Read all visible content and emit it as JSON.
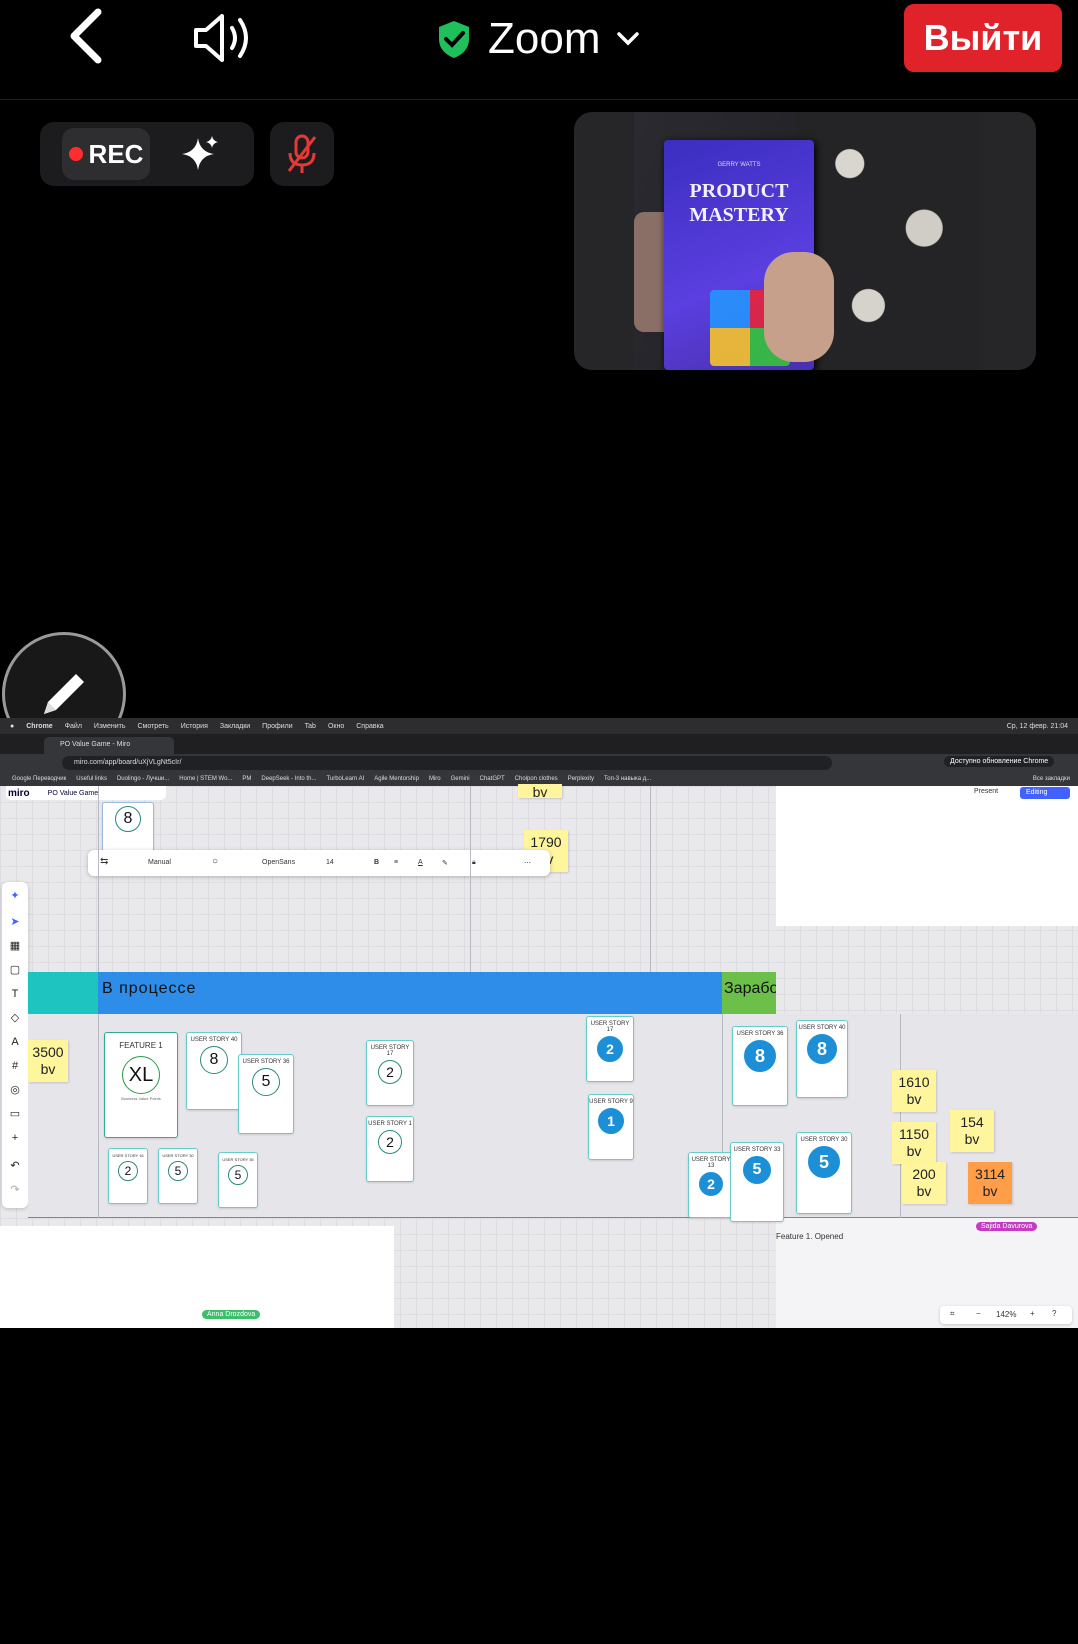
{
  "zoom": {
    "title": "Zoom",
    "exit_label": "Выйти",
    "rec_label": "REC",
    "accent_exit": "#e0232b",
    "shield_color": "#1fbf5b"
  },
  "video": {
    "book_author": "GERRY WATTS",
    "book_title_line1": "PRODUCT",
    "book_title_line2": "MASTERY"
  },
  "share": {
    "macbar": {
      "app": "Chrome",
      "menus": [
        "Файл",
        "Изменить",
        "Смотреть",
        "История",
        "Закладки",
        "Профили",
        "Tab",
        "Окно",
        "Справка"
      ],
      "clock": "Ср, 12 февр. 21:04"
    },
    "tab_title": "PO Value Game - Miro",
    "url": "miro.com/app/board/uXjVLgNt5cIr/",
    "update_label": "Доступно обновление Chrome",
    "bookmarks": [
      "Google Переводчик",
      "Useful links",
      "Duolingo - Лучши...",
      "Home | STEM Wo...",
      "PM",
      "DeepSeek - Into th...",
      "TurboLearn AI",
      "Agile Mentorship",
      "Miro",
      "Gemini",
      "ChatGPT",
      "Cholpon clothes",
      "Perplexity",
      "Топ-3 навыка д...",
      "Все закладки"
    ],
    "miro": {
      "logo": "miro",
      "board_name": "PO Value Game",
      "present_label": "Present",
      "editing_label": "Editing",
      "toolbar": {
        "connection": "Manual",
        "font": "OpenSans",
        "size": "14"
      },
      "lanes": {
        "blue": "В процессе",
        "green": "Зарабо"
      },
      "stickies": {
        "s3500": "3500\nbv",
        "s1790": "1790\nbv",
        "s1610": "1610\nbv",
        "s1150": "1150\nbv",
        "s154": "154\nbv",
        "s200": "200\nbv",
        "s3114": "3114\nbv",
        "top_bv": "bv"
      },
      "cards": {
        "feature1": {
          "title": "FEATURE 1",
          "value": "XL",
          "sub": "Business Value Points"
        },
        "us40a": {
          "title": "USER STORY 40",
          "value": "8"
        },
        "us36a": {
          "title": "USER STORY 36",
          "value": "5"
        },
        "us17a": {
          "title": "USER STORY 17",
          "value": "2"
        },
        "us1a": {
          "title": "USER STORY 1",
          "value": "2"
        },
        "small1": {
          "title": "USER STORY 16",
          "value": "2"
        },
        "small2": {
          "title": "USER STORY 30",
          "value": "5"
        },
        "small3": {
          "title": "USER STORY 35",
          "value": "5"
        },
        "top8": {
          "value": "8"
        },
        "us17b": {
          "title": "USER STORY 17",
          "value": "2"
        },
        "us9": {
          "title": "USER STORY 9",
          "value": "1"
        },
        "us36b": {
          "title": "USER STORY 36",
          "value": "8"
        },
        "us40b": {
          "title": "USER STORY 40",
          "value": "8"
        },
        "us13": {
          "title": "USER STORY 13",
          "value": "2"
        },
        "us33": {
          "title": "USER STORY 33",
          "value": "5"
        },
        "us30": {
          "title": "USER STORY 30",
          "value": "5"
        }
      },
      "feature_opened": "Feature 1. Opened",
      "cursor_sajida": "Sajida Davurova",
      "cursor_anna": "Anna Drozdova",
      "zoom_level": "142%"
    }
  }
}
